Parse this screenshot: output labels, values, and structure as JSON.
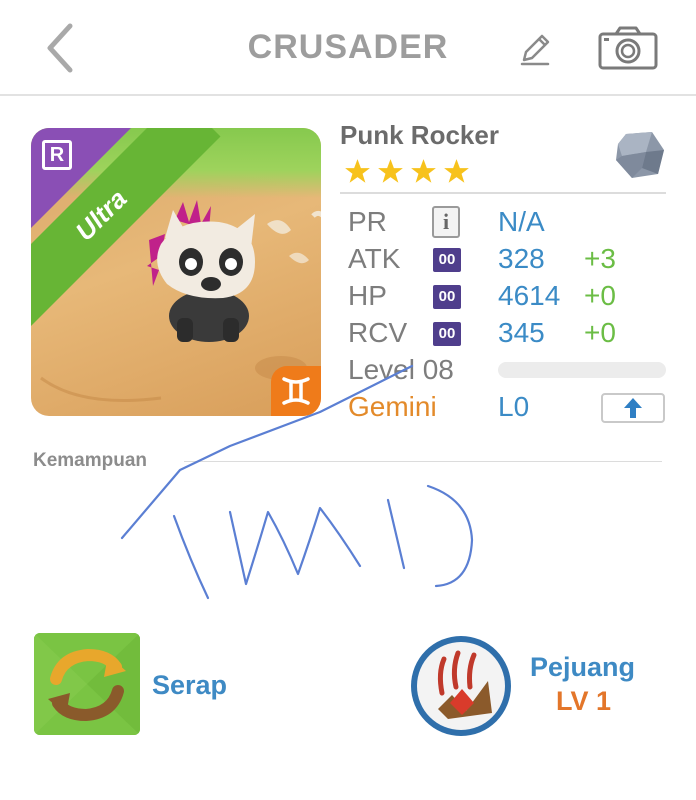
{
  "header": {
    "title": "CRUSADER",
    "back_icon": "chevron-left-icon",
    "edit_icon": "pencil-icon",
    "camera_icon": "camera-icon"
  },
  "monster": {
    "name": "Punk Rocker",
    "rarity_letter": "R",
    "tier_label": "Ultra",
    "star_count": 4,
    "element_icon": "gemini-icon",
    "class_gem_icon": "gray-gem-icon"
  },
  "stats": [
    {
      "label": "PR",
      "badge": "i",
      "value": "N/A",
      "bonus": ""
    },
    {
      "label": "ATK",
      "badge": "00",
      "value": "328",
      "bonus": "+3"
    },
    {
      "label": "HP",
      "badge": "00",
      "value": "4614",
      "bonus": "+0"
    },
    {
      "label": "RCV",
      "badge": "00",
      "value": "345",
      "bonus": "+0"
    }
  ],
  "level": {
    "label": "Level 08",
    "exp_fraction": 0.0
  },
  "zodiac": {
    "label": "Gemini",
    "value": "L0",
    "upgrade_icon": "arrow-up-icon"
  },
  "abilities": {
    "section_title": "Kemampuan",
    "skill": {
      "name": "Serap",
      "icon": "swap-arrows-icon"
    },
    "class": {
      "name": "Pejuang",
      "level": "LV 1",
      "icon": "claw-icon"
    }
  },
  "colors": {
    "accent_blue": "#3b8bc6",
    "bonus_green": "#6bbd45",
    "zodiac_orange": "#e38a2a",
    "ultra_green": "#67b535",
    "rarity_purple": "#8a4fb5",
    "plus_badge_purple": "#4f3e8c",
    "star_yellow": "#f7c21c",
    "scribble_blue": "#5b7fd3"
  }
}
